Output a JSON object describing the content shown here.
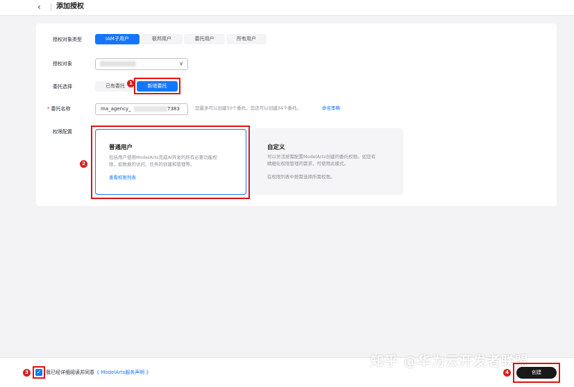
{
  "header": {
    "back_icon": "chevron-left-icon",
    "title": "添加授权"
  },
  "form": {
    "target_type": {
      "label": "授权对象类型",
      "options": [
        "IAM子用户",
        "联邦用户",
        "委托用户",
        "所有用户"
      ],
      "selected": "IAM子用户"
    },
    "target": {
      "label": "授权对象",
      "value": ""
    },
    "agency_choice": {
      "label": "委托选择",
      "options": [
        "已有委托",
        "新增委托"
      ],
      "selected": "新增委托"
    },
    "agency_name": {
      "required_mark": "*",
      "label": "委托名称",
      "value_prefix": "ma_agency_",
      "value_suffix": "7383",
      "hint": "您最多可以创建50个委托，您还可以创建34个委托。",
      "rule_link": "命名策略"
    },
    "permission": {
      "label": "权限配置",
      "cards": [
        {
          "title": "普通用户",
          "desc1": "包括用户使用ModelArts完成AI开发的所有必要功能权",
          "desc2": "限，如数据的访问、任务的创建和管理等。",
          "link": "查看权限列表"
        },
        {
          "title": "自定义",
          "desc1": "可以灵活按需配置ModelArts创建的委托权限。如您有",
          "desc2": "精细化权限管理的需求，可使用此模式。",
          "desc3": "在权限列表中按需选择所需权限。"
        }
      ],
      "selected": "普通用户"
    }
  },
  "footer": {
    "agree_checked": true,
    "agree_text": "我已经详细阅读并同意",
    "agree_link": "《 ModelArts服务声明 》",
    "create_label": "创建"
  },
  "annotations": {
    "badges": [
      "1",
      "2",
      "3",
      "4"
    ],
    "highlight_color": "#e01010"
  },
  "watermark": "知乎 @华为云开发者联盟",
  "colors": {
    "accent": "#1476ff",
    "required": "#e6142e",
    "button_dark": "#191919"
  }
}
